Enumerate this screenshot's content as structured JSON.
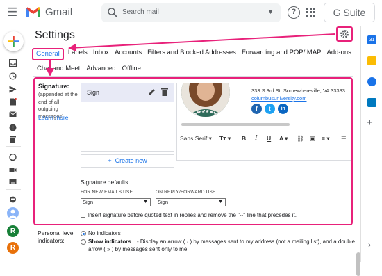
{
  "header": {
    "app_name": "Gmail",
    "search_placeholder": "Search mail",
    "gsuite_label": "G Suite"
  },
  "settings": {
    "title": "Settings",
    "tabs_row1": [
      "General",
      "Labels",
      "Inbox",
      "Accounts",
      "Filters and Blocked Addresses",
      "Forwarding and POP/IMAP",
      "Add-ons"
    ],
    "tabs_row2": [
      "Chat and Meet",
      "Advanced",
      "Offline"
    ],
    "active_tab": "General"
  },
  "signature": {
    "label": "Signature:",
    "sublabel": "(appended at the end of all outgoing messages)",
    "learn_more": "Learn more",
    "item_name": "Sign",
    "create_new": "Create new",
    "address": "333 S 3rd St. Somewhereville, VA 33333",
    "url": "columbusuniversity.com",
    "social": [
      "f",
      "t",
      "in"
    ],
    "font": "Sans Serif",
    "defaults_title": "Signature defaults",
    "new_emails_label": "FOR NEW EMAILS USE",
    "reply_label": "ON REPLY/FORWARD USE",
    "new_emails_value": "Sign",
    "reply_value": "Sign",
    "insert_text": "Insert signature before quoted text in replies and remove the \"--\" line that precedes it."
  },
  "personal": {
    "label": "Personal level indicators:",
    "opt1": "No indicators",
    "opt2_bold": "Show indicators",
    "opt2_line1": " - Display an arrow ( › ) by messages sent to my address (not a mailing list), and a double",
    "opt2_line2": "arrow ( » ) by messages sent only to me."
  },
  "colors": {
    "accent_pink": "#e8217a",
    "link_blue": "#1a73e8",
    "gmail_red": "#ea4335"
  },
  "rail_avatars": [
    "R",
    "R"
  ]
}
